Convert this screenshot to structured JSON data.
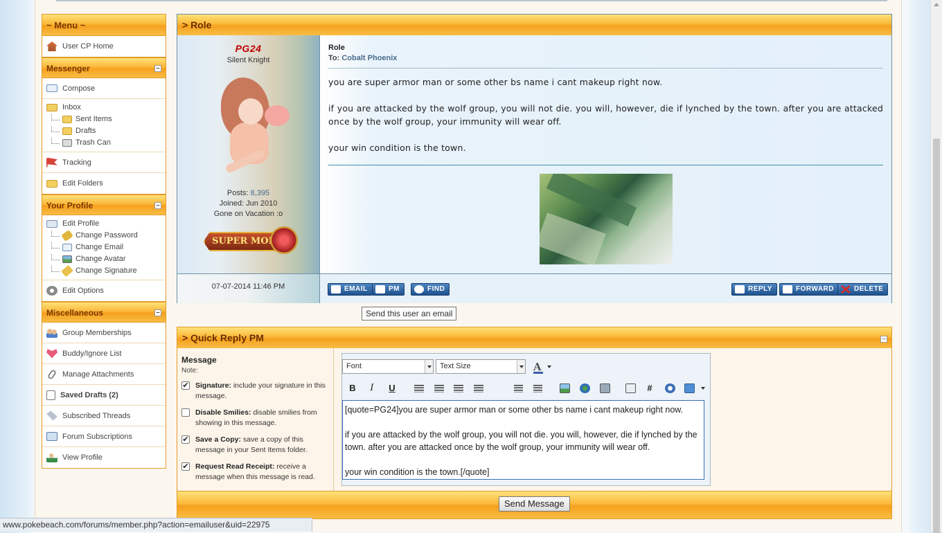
{
  "sidebar": {
    "menu_title": "~ Menu ~",
    "usercp_home": "User CP Home",
    "messenger": {
      "title": "Messenger",
      "compose": "Compose",
      "inbox": "Inbox",
      "sent_items": "Sent Items",
      "drafts": "Drafts",
      "trash_can": "Trash Can",
      "tracking": "Tracking",
      "edit_folders": "Edit Folders"
    },
    "your_profile": {
      "title": "Your Profile",
      "edit_profile": "Edit Profile",
      "change_password": "Change Password",
      "change_email": "Change Email",
      "change_avatar": "Change Avatar",
      "change_signature": "Change Signature",
      "edit_options": "Edit Options"
    },
    "misc": {
      "title": "Miscellaneous",
      "group_memberships": "Group Memberships",
      "buddy_ignore": "Buddy/Ignore List",
      "manage_attachments": "Manage Attachments",
      "saved_drafts": "Saved Drafts (2)",
      "subscribed_threads": "Subscribed Threads",
      "forum_subscriptions": "Forum Subscriptions",
      "view_profile": "View Profile"
    },
    "collapse_symbol": "–"
  },
  "role_panel": {
    "header": "> Role",
    "user": {
      "name": "PG24",
      "title": "Silent Knight",
      "posts_label": "Posts:",
      "posts_value": "8,395",
      "joined": "Joined: Jun 2010",
      "status": "Gone on Vacation :o",
      "badge": "SUPER MOD"
    },
    "message": {
      "subject": "Role",
      "to_label": "To:",
      "to_value": "Cobalt Phoenix",
      "para1": "you are super armor man or some other bs name i cant makeup right now.",
      "para2": "if you are attacked by the wolf group, you will not die. you will, however, die if lynched by the town. after you are attacked once by the wolf group, your immunity will wear off.",
      "para3": "your win condition is the town."
    },
    "date": "07-07-2014 11:46 PM",
    "buttons": {
      "email": "EMAIL",
      "pm": "PM",
      "find": "FIND",
      "reply": "REPLY",
      "forward": "FORWARD",
      "delete": "DELETE"
    }
  },
  "tooltip": "Send this user an email",
  "quick_reply": {
    "header": "> Quick Reply PM",
    "collapse_symbol": "–",
    "message_label": "Message",
    "note_label": "Note:",
    "options": {
      "signature_bold": "Signature:",
      "signature_text": "include your signature in this message.",
      "signature_checked": true,
      "smilies_bold": "Disable Smilies:",
      "smilies_text": "disable smilies from showing in this message.",
      "smilies_checked": false,
      "copy_bold": "Save a Copy:",
      "copy_text": "save a copy of this message in your Sent Items folder.",
      "copy_checked": true,
      "receipt_bold": "Request Read Receipt:",
      "receipt_text": "receive a message when this message is read.",
      "receipt_checked": true
    },
    "editor": {
      "font_select": "Font",
      "size_select": "Text Size",
      "font_color_glyph": "A",
      "bold": "B",
      "italic": "I",
      "underline": "U",
      "code": "#",
      "text": "[quote=PG24]you are super armor man or some other bs name i cant makeup right now.\n\nif you are attacked by the wolf group, you will not die. you will, however, die if lynched by the town. after you are attacked once by the wolf group, your immunity will wear off.\n\nyour win condition is the town.[/quote]"
    },
    "send_button": "Send Message"
  },
  "statusbar": "www.pokebeach.com/forums/member.php?action=emailuser&uid=22975",
  "check_mark": "✔"
}
